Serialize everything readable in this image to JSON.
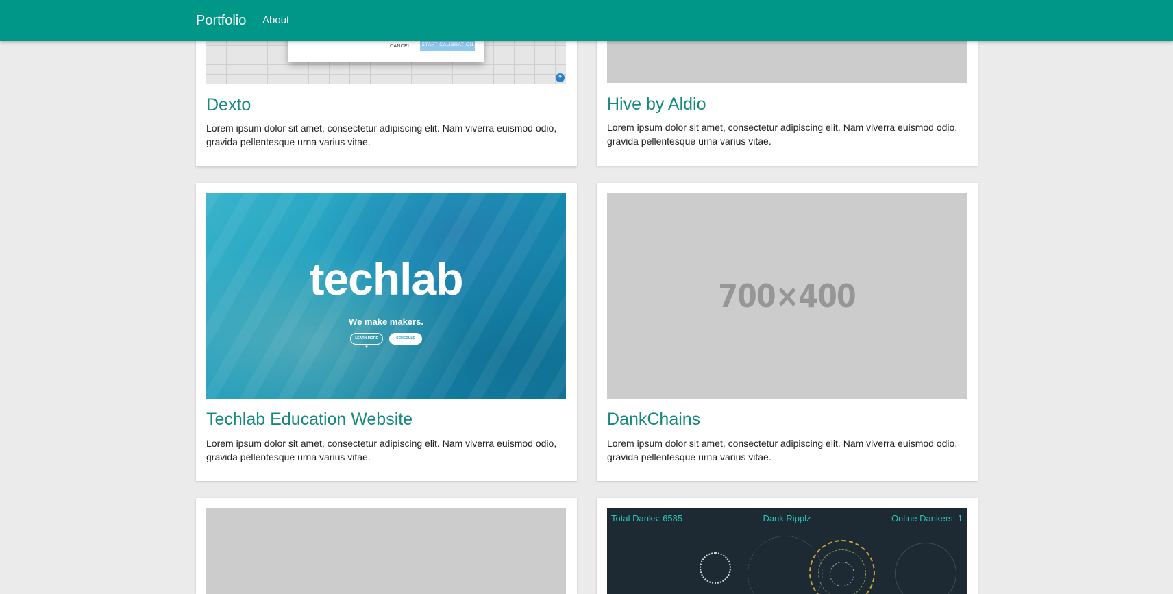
{
  "navbar": {
    "brand": "Portfolio",
    "links": [
      {
        "label": "About"
      }
    ]
  },
  "colors": {
    "navbar": "#009688",
    "title": "#15897f",
    "background": "#ebebeb"
  },
  "cards": [
    {
      "title": "Dexto",
      "text": "Lorem ipsum dolor sit amet, consectetur adipiscing elit. Nam viverra euismod odio, gravida pellentesque urna varius vitae.",
      "image": {
        "cancel": "CANCEL",
        "start": "START CALIBRATION",
        "icon": "help-icon"
      }
    },
    {
      "title": "Hive by Aldio",
      "text": "Lorem ipsum dolor sit amet, consectetur adipiscing elit. Nam viverra euismod odio, gravida pellentesque urna varius vitae."
    },
    {
      "title": "Techlab Education Website",
      "text": "Lorem ipsum dolor sit amet, consectetur adipiscing elit. Nam viverra euismod odio, gravida pellentesque urna varius vitae.",
      "image": {
        "word": "techlab",
        "tagline": "We make makers.",
        "learn": "LEARN MORE",
        "schedule": "SCHEDULE"
      }
    },
    {
      "title": "DankChains",
      "text": "Lorem ipsum dolor sit amet, consectetur adipiscing elit. Nam viverra euismod odio, gravida pellentesque urna varius vitae.",
      "image": {
        "placeholder": "700×400"
      }
    },
    {
      "title": "",
      "text": ""
    },
    {
      "title": "",
      "text": "",
      "image": {
        "total": "Total Danks: 6585",
        "name": "Dank Ripplz",
        "online": "Online Dankers: 1"
      }
    }
  ]
}
